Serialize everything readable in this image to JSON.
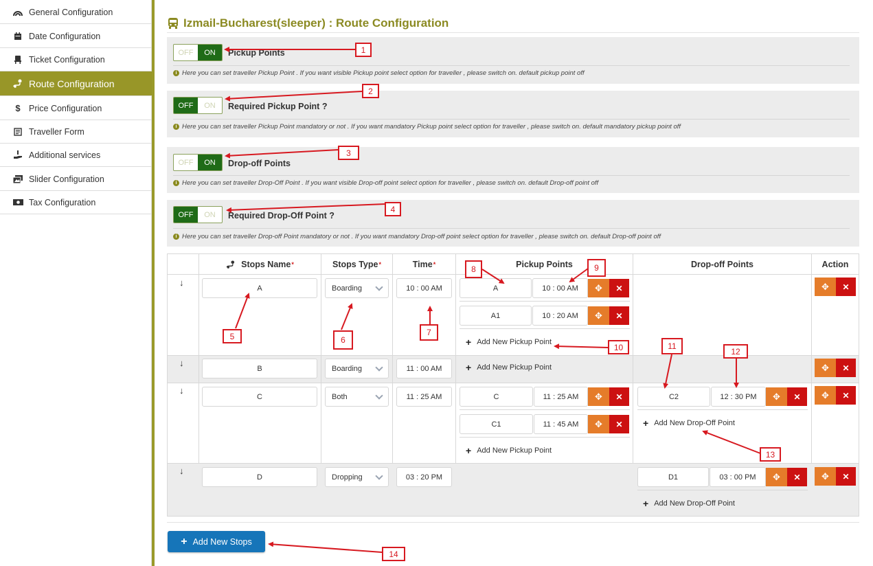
{
  "sidebar": {
    "items": [
      {
        "label": "General Configuration",
        "icon": "rainbow-icon"
      },
      {
        "label": "Date Configuration",
        "icon": "calendar-icon"
      },
      {
        "label": "Ticket Configuration",
        "icon": "seat-icon"
      },
      {
        "label": "Route Configuration",
        "icon": "route-icon",
        "active": true
      },
      {
        "label": "Price Configuration",
        "icon": "dollar-icon"
      },
      {
        "label": "Traveller Form",
        "icon": "form-icon"
      },
      {
        "label": "Additional services",
        "icon": "hand-service-icon"
      },
      {
        "label": "Slider Configuration",
        "icon": "images-icon"
      },
      {
        "label": "Tax Configuration",
        "icon": "money-icon"
      }
    ]
  },
  "header": {
    "title": "Izmail-Bucharest(sleeper) : Route Configuration",
    "icon": "bus-icon"
  },
  "toggles": [
    {
      "off": "OFF",
      "on": "ON",
      "state": "on",
      "label": "Pickup Points",
      "help": "Here you can set traveller Pickup Point . If you want visible Pickup point select option for traveller , please switch on. default pickup point off"
    },
    {
      "off": "OFF",
      "on": "ON",
      "state": "off",
      "label": "Required Pickup Point ?",
      "help": "Here you can set traveller Pickup Point mandatory or not . If you want mandatory Pickup point select option for traveller , please switch on. default mandatory pickup point off"
    },
    {
      "off": "OFF",
      "on": "ON",
      "state": "on",
      "label": "Drop-off Points",
      "help": "Here you can set traveller Drop-Off Point . If you want visible Drop-off point select option for traveller , please switch on. default Drop-off point off"
    },
    {
      "off": "OFF",
      "on": "ON",
      "state": "off",
      "label": "Required Drop-Off Point ?",
      "help": "Here you can set traveller Drop-off Point mandatory or not . If you want mandatory Drop-off point select option for traveller , please switch on. default Drop-off point off"
    }
  ],
  "table": {
    "headers": {
      "stops_name": "Stops Name",
      "stops_type": "Stops Type",
      "time": "Time",
      "pickup": "Pickup Points",
      "dropoff": "Drop-off Points",
      "action": "Action"
    },
    "required_mark": "*",
    "add_pickup": "Add New Pickup Point",
    "add_dropoff": "Add New Drop-Off Point",
    "rows": [
      {
        "name": "A",
        "type": "Boarding",
        "time": "10 : 00  AM",
        "pickups": [
          {
            "name": "A",
            "time": "10 : 00  AM"
          },
          {
            "name": "A1",
            "time": "10 : 20  AM"
          }
        ]
      },
      {
        "name": "B",
        "type": "Boarding",
        "time": "11 : 00  AM"
      },
      {
        "name": "C",
        "type": "Both",
        "time": "11 : 25  AM",
        "pickups": [
          {
            "name": "C",
            "time": "11 : 25  AM"
          },
          {
            "name": "C1",
            "time": "11 : 45  AM"
          }
        ],
        "dropoffs": [
          {
            "name": "C2",
            "time": "12 : 30  PM"
          }
        ]
      },
      {
        "name": "D",
        "type": "Dropping",
        "time": "03 : 20  PM",
        "dropoffs": [
          {
            "name": "D1",
            "time": "03 : 00  PM"
          }
        ]
      }
    ]
  },
  "add_stops_label": "Add New Stops",
  "annotations": [
    "1",
    "2",
    "3",
    "4",
    "5",
    "6",
    "7",
    "8",
    "9",
    "10",
    "11",
    "12",
    "13",
    "14"
  ],
  "colors": {
    "accent": "#989628",
    "title": "#8b8a22",
    "toggle_on": "#1f6b17",
    "move": "#e57c2a",
    "delete": "#cc1111",
    "primary": "#1675b9",
    "annotation": "#d71920"
  }
}
